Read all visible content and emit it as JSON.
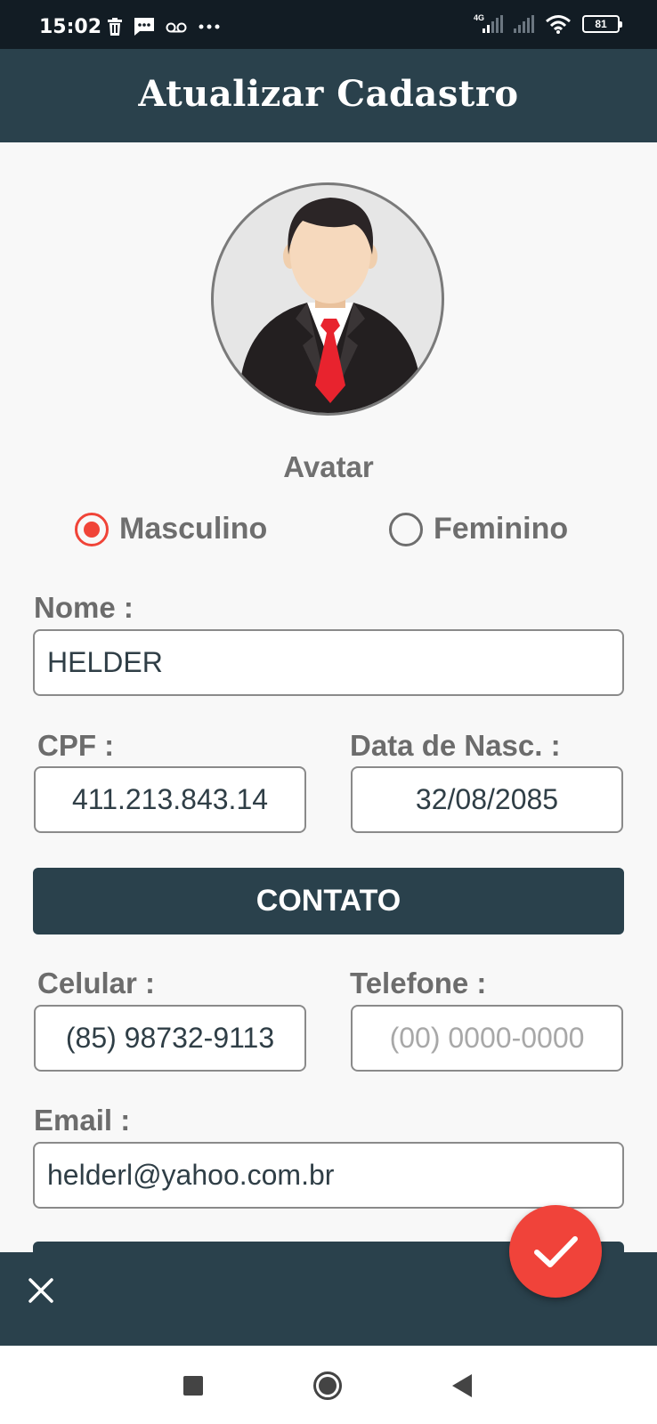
{
  "status": {
    "time": "15:02",
    "network": "4G",
    "battery": "81"
  },
  "header": {
    "title": "Atualizar Cadastro"
  },
  "avatar": {
    "label": "Avatar"
  },
  "gender": {
    "options": [
      {
        "label": "Masculino",
        "selected": true
      },
      {
        "label": "Feminino",
        "selected": false
      }
    ]
  },
  "form": {
    "nome": {
      "label": "Nome :",
      "value": "HELDER"
    },
    "cpf": {
      "label": "CPF :",
      "value": "411.213.843.14"
    },
    "nascimento": {
      "label": "Data de Nasc. :",
      "value": "32/08/2085"
    },
    "contato_title": "CONTATO",
    "celular": {
      "label": "Celular :",
      "value": "(85) 98732-9113"
    },
    "telefone": {
      "label": "Telefone :",
      "placeholder": "(00) 0000-0000"
    },
    "email": {
      "label": "Email :",
      "value": "helderl@yahoo.com.br"
    }
  },
  "colors": {
    "primary": "#2a414c",
    "accent": "#f0433a",
    "statusbar": "#121c24"
  },
  "icons": {
    "close": "close-icon",
    "confirm": "check-icon",
    "nav_recent": "square-icon",
    "nav_home": "circle-icon",
    "nav_back": "triangle-back-icon"
  }
}
